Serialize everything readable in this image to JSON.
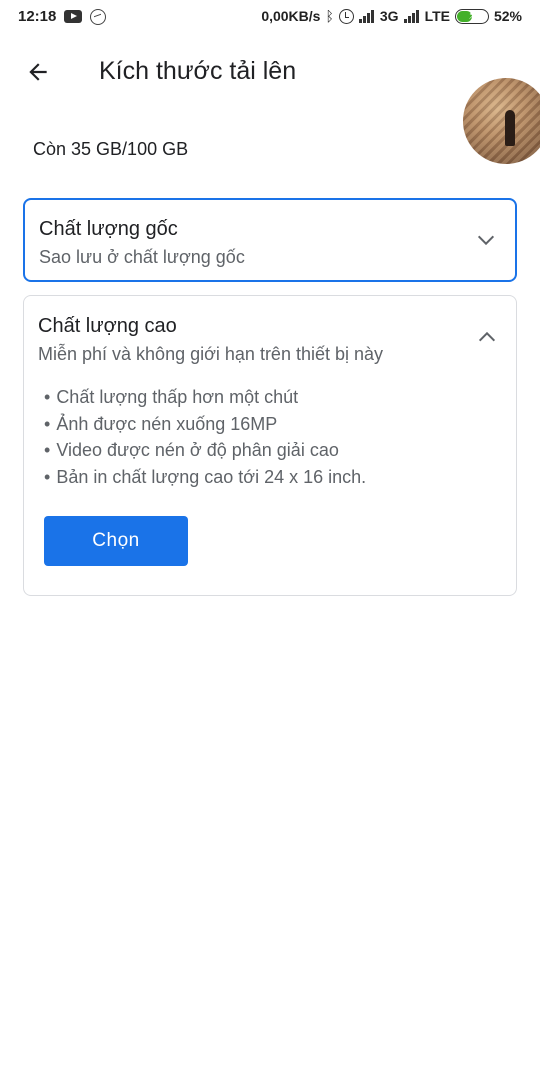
{
  "status_bar": {
    "time": "12:18",
    "network_speed": "0,00KB/s",
    "network_3g": "3G",
    "network_lte": "LTE",
    "battery_percent": "52%",
    "battery_level": 0.52,
    "icons": [
      "youtube-icon",
      "messenger-icon",
      "bluetooth-icon",
      "alarm-icon",
      "signal-icon",
      "battery-icon"
    ]
  },
  "app_bar": {
    "title": "Kích thước tải lên",
    "back_icon": "arrow-back-icon"
  },
  "storage": {
    "text": "Còn 35 GB/100 GB"
  },
  "options": {
    "original": {
      "title": "Chất lượng gốc",
      "subtitle": "Sao lưu ở chất lượng gốc",
      "icon": "chevron-down-icon",
      "selected": true
    },
    "high": {
      "title": "Chất lượng cao",
      "subtitle": "Miễn phí và không giới hạn trên thiết bị này",
      "icon": "chevron-up-icon",
      "features": [
        "Chất lượng thấp hơn một chút",
        "Ảnh được nén xuống 16MP",
        "Video được nén ở độ phân giải cao",
        "Bản in chất lượng cao tới 24 x 16 inch."
      ],
      "select_label": "Chọn"
    }
  },
  "colors": {
    "accent": "#1a73e8",
    "text_primary": "#202124",
    "text_secondary": "#5f6368",
    "border": "#dadce0"
  }
}
